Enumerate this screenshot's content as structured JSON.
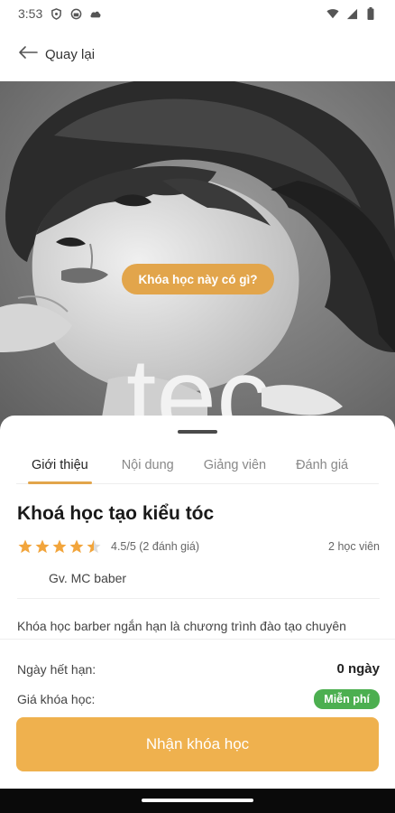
{
  "status_bar": {
    "time": "3:53",
    "icons": [
      "shield-icon",
      "android-icon",
      "cloud-icon",
      "wifi-icon",
      "signal-icon",
      "battery-icon"
    ]
  },
  "topbar": {
    "back_label": "Quay lại",
    "back_icon": "arrow-left-icon"
  },
  "hero": {
    "banner_text": "tec",
    "pill_label": "Khóa học này có gì?",
    "pill_color": "#e2a54b"
  },
  "tabs": [
    {
      "label": "Giới thiệu",
      "active": true
    },
    {
      "label": "Nội dung",
      "active": false
    },
    {
      "label": "Giảng viên",
      "active": false
    },
    {
      "label": "Đánh giá",
      "active": false
    }
  ],
  "course": {
    "title": "Khoá học tạo kiểu tóc",
    "rating": 4.5,
    "rating_text": "4.5/5 (2 đánh giá)",
    "students": "2 học viên",
    "instructor": "Gv. MC baber",
    "description": "Khóa học barber ngắn hạn là chương trình đào tạo chuyên"
  },
  "footer": {
    "expiry_label": "Ngày hết hạn:",
    "expiry_value": "0 ngày",
    "price_label": "Giá khóa học:",
    "price_badge": "Miễn phí",
    "cta_label": "Nhận khóa học"
  },
  "colors": {
    "accent": "#efb14e",
    "star": "#f2a53c",
    "free_badge": "#4caf50"
  }
}
